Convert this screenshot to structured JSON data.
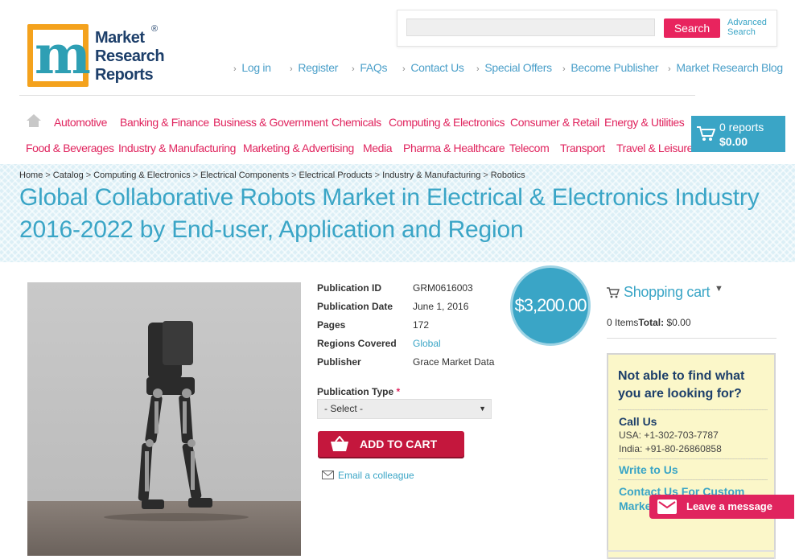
{
  "logo": {
    "line1": "Market",
    "line2": "Research",
    "line3": "Reports",
    "reg": "®"
  },
  "search": {
    "placeholder": "",
    "button": "Search",
    "advanced": "Advanced\nSearch"
  },
  "top_links": [
    "Log in",
    "Register",
    "FAQs",
    "Contact Us",
    "Special Offers",
    "Become Publisher",
    "Market Research Blog"
  ],
  "nav_row1": [
    "Automotive",
    "Banking & Finance",
    "Business & Government",
    "Chemicals",
    "Computing & Electronics",
    "Consumer & Retail",
    "Energy & Utilities"
  ],
  "nav_row2": [
    "Food & Beverages",
    "Industry & Manufacturing",
    "Marketing & Advertising",
    "Media",
    "Pharma & Healthcare",
    "Telecom",
    "Transport",
    "Travel & Leisure"
  ],
  "cart": {
    "reports": "0 reports",
    "total": "$0.00"
  },
  "breadcrumb": [
    "Home",
    "Catalog",
    "Computing & Electronics",
    "Electrical Components",
    "Electrical Products",
    "Industry & Manufacturing",
    "Robotics"
  ],
  "title": "Global Collaborative Robots Market in Electrical & Electronics Industry 2016-2022 by End-user, Application and Region",
  "details": [
    {
      "label": "Publication ID",
      "value": "GRM0616003"
    },
    {
      "label": "Publication Date",
      "value": "June 1, 2016"
    },
    {
      "label": "Pages",
      "value": "172"
    },
    {
      "label": "Regions Covered",
      "value": "Global"
    },
    {
      "label": "Publisher",
      "value": "Grace Market Data"
    }
  ],
  "price": "$3,200.00",
  "publication_type": {
    "label": "Publication Type",
    "required": "*",
    "selected": "- Select -"
  },
  "add_to_cart": "ADD TO CART",
  "email_colleague": "Email a colleague",
  "shopping_cart": {
    "heading": "Shopping cart",
    "items": "0 Items",
    "total_label": "Total:",
    "total_value": "$0.00"
  },
  "help": {
    "question": "Not able to find what you are looking for?",
    "call_us": "Call Us",
    "usa": "USA: +1-302-703-7787",
    "india": "India: +91-80-26860858",
    "write": "Write to Us",
    "custom": "Contact Us For Custom Market"
  },
  "leave_message": "Leave a message",
  "colors": {
    "accent": "#3aa5c6",
    "brand_pink": "#e0245e",
    "cart_red": "#c4173d"
  }
}
